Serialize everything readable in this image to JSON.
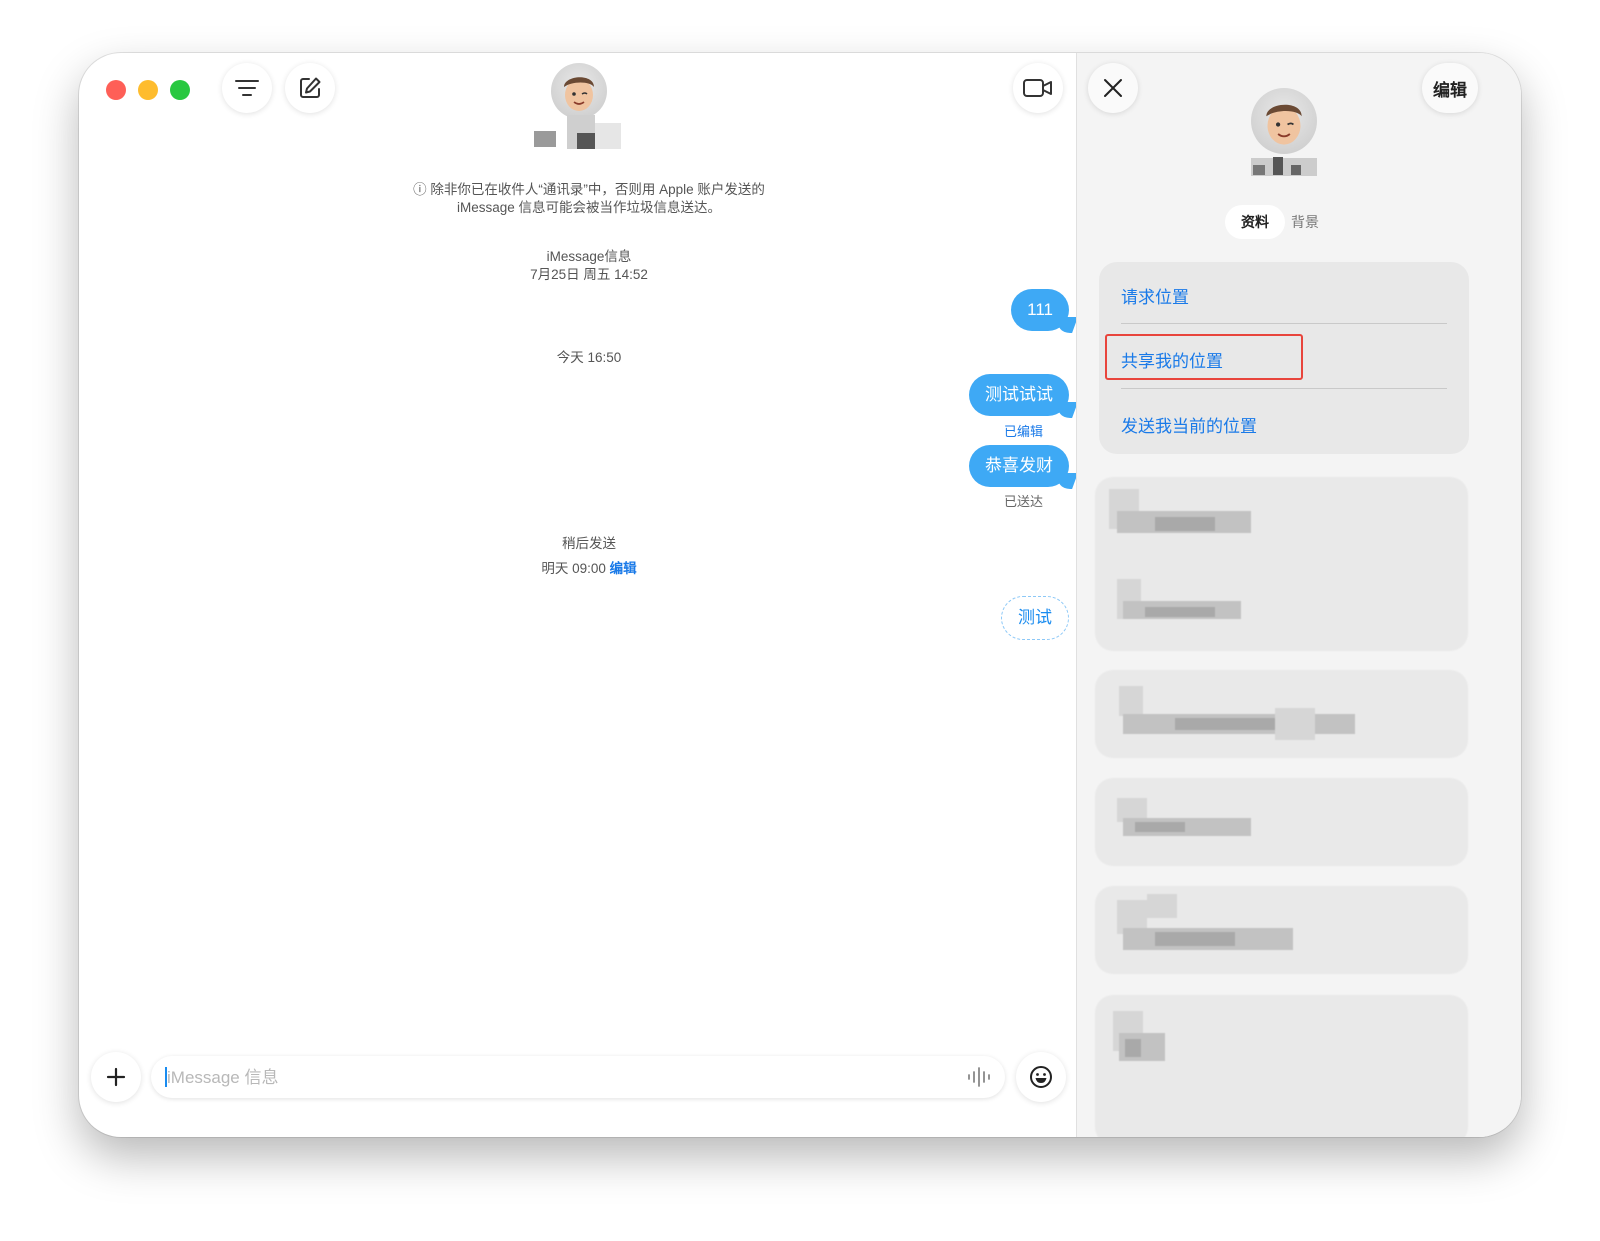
{
  "window": {
    "traffic_lights": [
      "close",
      "minimize",
      "maximize"
    ]
  },
  "toolbar": {
    "filter_icon": "filter-lines-icon",
    "compose_icon": "compose-icon",
    "video_icon": "video-camera-icon"
  },
  "chat": {
    "notice_line1": "ⓘ 除非你已在收件人“通讯录”中，否则用 Apple 账户发送的",
    "notice_line2": "iMessage 信息可能会被当作垃圾信息送达。",
    "header1_line1": "iMessage信息",
    "header1_line2": "7月25日 周五 14:52",
    "msg1": "111",
    "header2": "今天 16:50",
    "msg2": "测试试试",
    "msg2_status": "已编辑",
    "msg3": "恭喜发财",
    "msg3_status": "已送达",
    "scheduled_label": "稍后发送",
    "scheduled_time": "明天 09:00",
    "scheduled_edit": "编辑",
    "msg4": "测试"
  },
  "input": {
    "placeholder": "iMessage 信息",
    "add_icon": "plus-icon",
    "voice_icon": "waveform-icon",
    "emoji_icon": "emoji-icon"
  },
  "details": {
    "close_icon": "close-icon",
    "edit_label": "编辑",
    "tab_profile": "资料",
    "tab_background": "背景",
    "action_request": "请求位置",
    "action_share": "共享我的位置",
    "action_send": "发送我当前的位置"
  }
}
